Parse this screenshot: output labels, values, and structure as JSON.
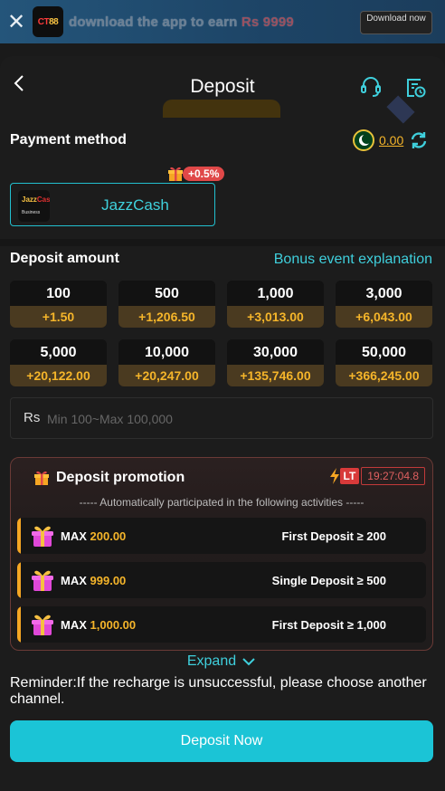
{
  "banner": {
    "close": "✕",
    "logo_text_a": "CT",
    "logo_text_b": "88",
    "text": "download the app to earn",
    "amount": "Rs 9999",
    "button": "Download now"
  },
  "header": {
    "title": "Deposit",
    "icons": [
      "back-icon",
      "support-icon",
      "history-icon"
    ]
  },
  "payment": {
    "label": "Payment method",
    "balance": "0.00",
    "method": {
      "name": "JazzCash",
      "logo_line1_a": "Jazz",
      "logo_line1_b": "Cash",
      "logo_line2": "Business",
      "promo": "+0.5%"
    }
  },
  "amount": {
    "label": "Deposit amount",
    "bonus_link": "Bonus event explanation",
    "options": [
      {
        "value": "100",
        "bonus": "+1.50"
      },
      {
        "value": "500",
        "bonus": "+1,206.50"
      },
      {
        "value": "1,000",
        "bonus": "+3,013.00"
      },
      {
        "value": "3,000",
        "bonus": "+6,043.00"
      },
      {
        "value": "5,000",
        "bonus": "+20,122.00"
      },
      {
        "value": "10,000",
        "bonus": "+20,247.00"
      },
      {
        "value": "30,000",
        "bonus": "+135,746.00"
      },
      {
        "value": "50,000",
        "bonus": "+366,245.00"
      }
    ],
    "input_prefix": "Rs",
    "input_placeholder": "Min 100~Max 100,000"
  },
  "promotion": {
    "title": "Deposit promotion",
    "timer_badge": "LT",
    "timer": "19:27:04.8",
    "subtitle": "----- Automatically participated in the following activities -----",
    "items": [
      {
        "max_label": "MAX",
        "max_value": "200.00",
        "condition": "First Deposit ≥ 200"
      },
      {
        "max_label": "MAX",
        "max_value": "999.00",
        "condition": "Single Deposit ≥ 500"
      },
      {
        "max_label": "MAX",
        "max_value": "1,000.00",
        "condition": "First Deposit ≥ 1,000"
      }
    ]
  },
  "expand_label": "Expand",
  "reminder": "Reminder:If the recharge is unsuccessful, please choose another channel.",
  "deposit_button": "Deposit Now",
  "colors": {
    "accent": "#1bc4d6",
    "gold": "#f5b52a",
    "danger": "#e04848"
  }
}
